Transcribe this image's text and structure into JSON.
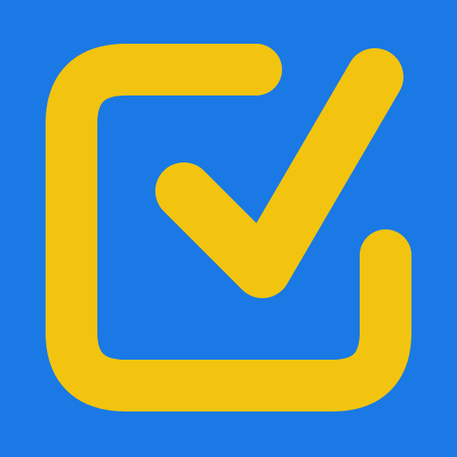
{
  "icon": {
    "name": "checkbox-checked-icon",
    "colors": {
      "background": "#1a79e4",
      "foreground": "#f2c40f"
    }
  }
}
